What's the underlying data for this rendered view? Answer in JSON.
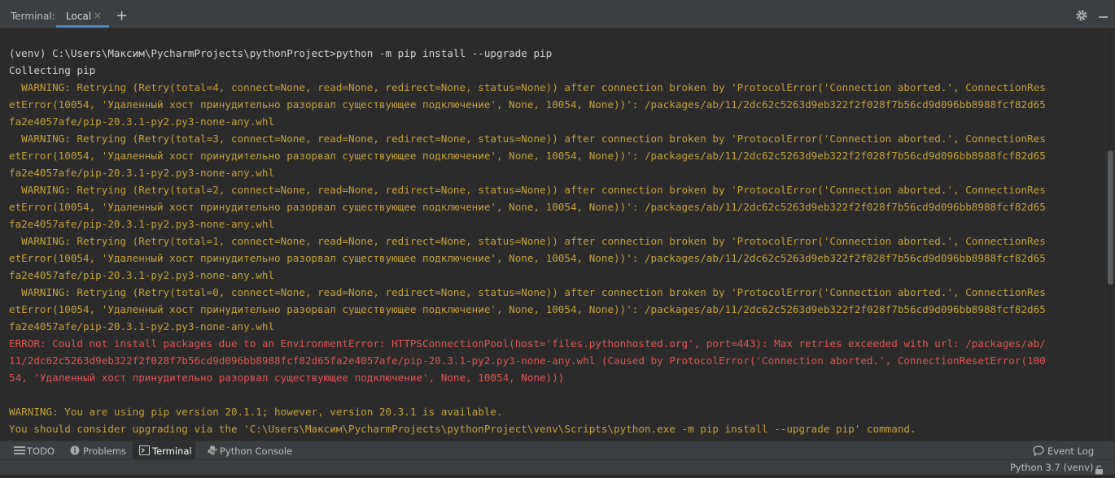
{
  "tabbar": {
    "title": "Terminal:",
    "active_tab": "Local",
    "close_glyph": "×",
    "add_glyph": "+"
  },
  "terminal": {
    "lines": [
      {
        "kind": "cmd",
        "text": "(venv) C:\\Users\\Максим\\PycharmProjects\\pythonProject>python -m pip install --upgrade pip"
      },
      {
        "kind": "cmd",
        "text": "Collecting pip"
      },
      {
        "kind": "warn",
        "text": "  WARNING: Retrying (Retry(total=4, connect=None, read=None, redirect=None, status=None)) after connection broken by 'ProtocolError('Connection aborted.', ConnectionRes"
      },
      {
        "kind": "warn",
        "text": "etError(10054, 'Удаленный хост принудительно разорвал существующее подключение', None, 10054, None))': /packages/ab/11/2dc62c5263d9eb322f2f028f7b56cd9d096bb8988fcf82d65"
      },
      {
        "kind": "warn",
        "text": "fa2e4057afe/pip-20.3.1-py2.py3-none-any.whl"
      },
      {
        "kind": "warn",
        "text": "  WARNING: Retrying (Retry(total=3, connect=None, read=None, redirect=None, status=None)) after connection broken by 'ProtocolError('Connection aborted.', ConnectionRes"
      },
      {
        "kind": "warn",
        "text": "etError(10054, 'Удаленный хост принудительно разорвал существующее подключение', None, 10054, None))': /packages/ab/11/2dc62c5263d9eb322f2f028f7b56cd9d096bb8988fcf82d65"
      },
      {
        "kind": "warn",
        "text": "fa2e4057afe/pip-20.3.1-py2.py3-none-any.whl"
      },
      {
        "kind": "warn",
        "text": "  WARNING: Retrying (Retry(total=2, connect=None, read=None, redirect=None, status=None)) after connection broken by 'ProtocolError('Connection aborted.', ConnectionRes"
      },
      {
        "kind": "warn",
        "text": "etError(10054, 'Удаленный хост принудительно разорвал существующее подключение', None, 10054, None))': /packages/ab/11/2dc62c5263d9eb322f2f028f7b56cd9d096bb8988fcf82d65"
      },
      {
        "kind": "warn",
        "text": "fa2e4057afe/pip-20.3.1-py2.py3-none-any.whl"
      },
      {
        "kind": "warn",
        "text": "  WARNING: Retrying (Retry(total=1, connect=None, read=None, redirect=None, status=None)) after connection broken by 'ProtocolError('Connection aborted.', ConnectionRes"
      },
      {
        "kind": "warn",
        "text": "etError(10054, 'Удаленный хост принудительно разорвал существующее подключение', None, 10054, None))': /packages/ab/11/2dc62c5263d9eb322f2f028f7b56cd9d096bb8988fcf82d65"
      },
      {
        "kind": "warn",
        "text": "fa2e4057afe/pip-20.3.1-py2.py3-none-any.whl"
      },
      {
        "kind": "warn",
        "text": "  WARNING: Retrying (Retry(total=0, connect=None, read=None, redirect=None, status=None)) after connection broken by 'ProtocolError('Connection aborted.', ConnectionRes"
      },
      {
        "kind": "warn",
        "text": "etError(10054, 'Удаленный хост принудительно разорвал существующее подключение', None, 10054, None))': /packages/ab/11/2dc62c5263d9eb322f2f028f7b56cd9d096bb8988fcf82d65"
      },
      {
        "kind": "warn",
        "text": "fa2e4057afe/pip-20.3.1-py2.py3-none-any.whl"
      },
      {
        "kind": "err",
        "text": "ERROR: Could not install packages due to an EnvironmentError: HTTPSConnectionPool(host='files.pythonhosted.org', port=443): Max retries exceeded with url: /packages/ab/"
      },
      {
        "kind": "err",
        "text": "11/2dc62c5263d9eb322f2f028f7b56cd9d096bb8988fcf82d65fa2e4057afe/pip-20.3.1-py2.py3-none-any.whl (Caused by ProtocolError('Connection aborted.', ConnectionResetError(100"
      },
      {
        "kind": "err",
        "text": "54, 'Удаленный хост принудительно разорвал существующее подключение', None, 10054, None)))"
      },
      {
        "kind": "cmd",
        "text": ""
      },
      {
        "kind": "warn",
        "text": "WARNING: You are using pip version 20.1.1; however, version 20.3.1 is available."
      },
      {
        "kind": "warn",
        "text": "You should consider upgrading via the 'C:\\Users\\Максим\\PycharmProjects\\pythonProject\\venv\\Scripts\\python.exe -m pip install --upgrade pip' command."
      }
    ]
  },
  "toolbar": {
    "todo": "TODO",
    "problems": "Problems",
    "terminal": "Terminal",
    "python_console": "Python Console",
    "event_log": "Event Log"
  },
  "statusbar": {
    "interpreter": "Python 3.7 (venv)"
  },
  "colors": {
    "command": "#d4d4d4",
    "warning": "#c5a13a",
    "error": "#e05555",
    "accent": "#4a88c7"
  }
}
